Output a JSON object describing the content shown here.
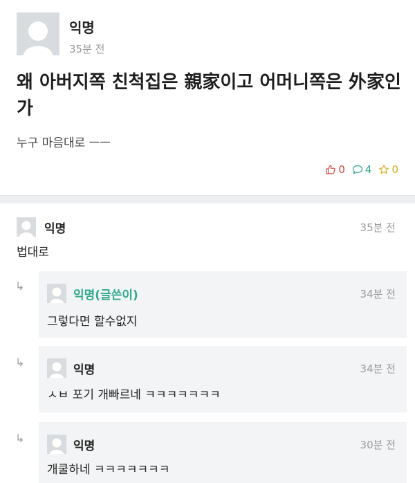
{
  "post": {
    "author": "익명",
    "time": "35분 전",
    "title": "왜 아버지쪽 친척집은 親家이고 어머니쪽은 外家인가",
    "body": "누구 마음대로 ㅡㅡ",
    "stats": {
      "likes": "0",
      "comments": "4",
      "scraps": "0"
    },
    "colors": {
      "like": "#d0463b",
      "comment": "#2fa88c",
      "scrap": "#d4aa16"
    },
    "icons": [
      "thumbs-up-icon",
      "speech-bubble-icon",
      "star-icon"
    ]
  },
  "comments": [
    {
      "author": "익명",
      "time": "35분 전",
      "text": "법대로",
      "is_reply": false
    }
  ],
  "replies": [
    {
      "author": "익명(글쓴이)",
      "time": "34분 전",
      "text": "그렇다면 할수없지",
      "is_op": true
    },
    {
      "author": "익명",
      "time": "34분 전",
      "text": "ㅅㅂ 포기 개빠르네 ㅋㅋㅋㅋㅋㅋㅋ",
      "is_op": false
    },
    {
      "author": "익명",
      "time": "30분 전",
      "text": "개쿨하네 ㅋㅋㅋㅋㅋㅋㅋ",
      "is_op": false
    }
  ],
  "reply_arrow": "↳"
}
